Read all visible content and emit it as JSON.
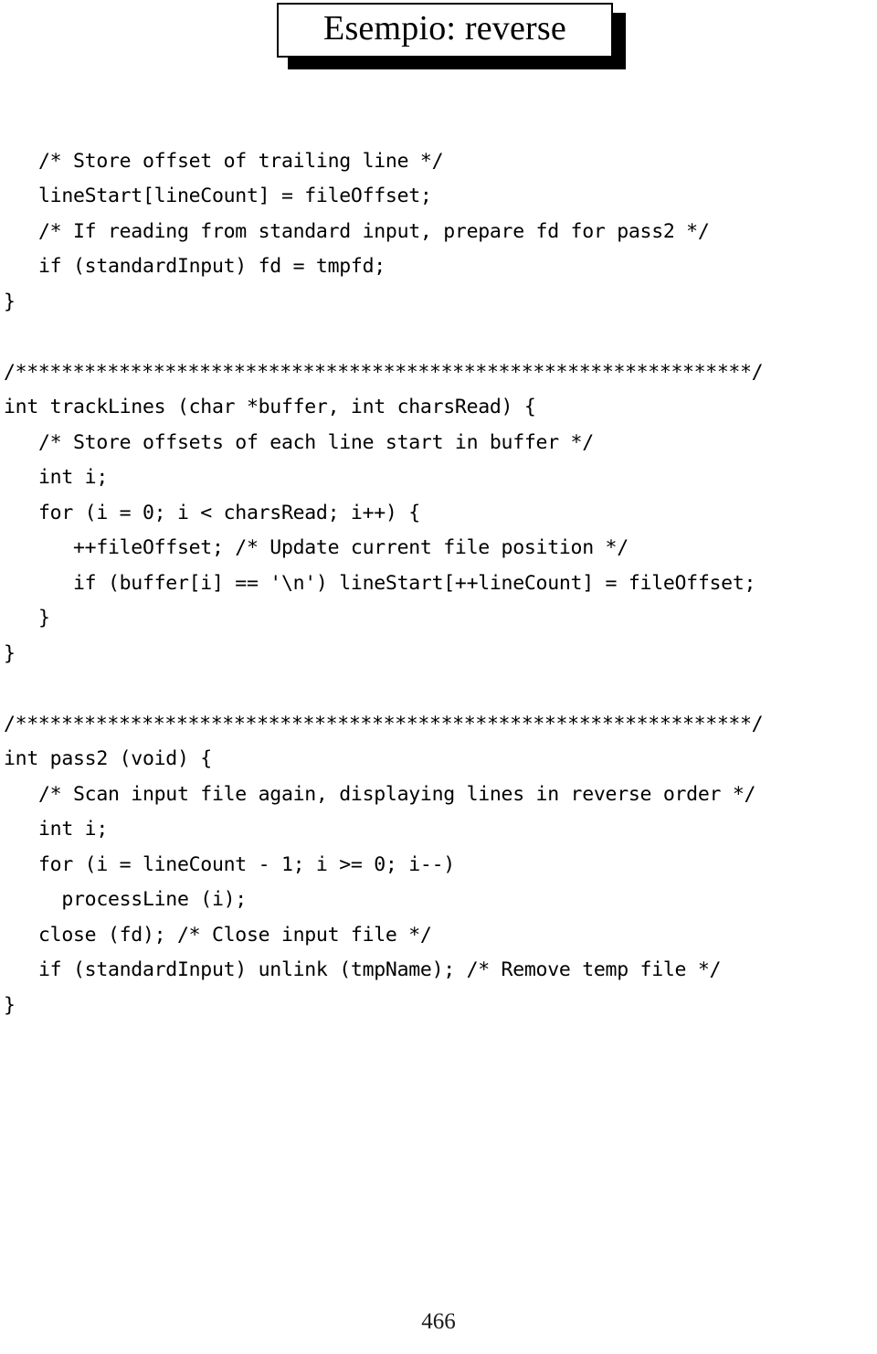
{
  "slide": {
    "title": "Esempio: reverse",
    "page_number": "466",
    "accent_color": "#000000",
    "background_color": "#ffffff"
  },
  "code": {
    "language": "C",
    "lines": [
      "   /* Store offset of trailing line */",
      "   lineStart[lineCount] = fileOffset;",
      "   /* If reading from standard input, prepare fd for pass2 */",
      "   if (standardInput) fd = tmpfd;",
      "}",
      "",
      "/****************************************************************/",
      "int trackLines (char *buffer, int charsRead) {",
      "   /* Store offsets of each line start in buffer */",
      "   int i;",
      "   for (i = 0; i < charsRead; i++) {",
      "      ++fileOffset; /* Update current file position */",
      "      if (buffer[i] == '\\n') lineStart[++lineCount] = fileOffset;",
      "   }",
      "}",
      "",
      "/****************************************************************/",
      "int pass2 (void) {",
      "   /* Scan input file again, displaying lines in reverse order */",
      "   int i;",
      "   for (i = lineCount - 1; i >= 0; i--)",
      "     processLine (i);",
      "   close (fd); /* Close input file */",
      "   if (standardInput) unlink (tmpName); /* Remove temp file */",
      "}"
    ]
  }
}
